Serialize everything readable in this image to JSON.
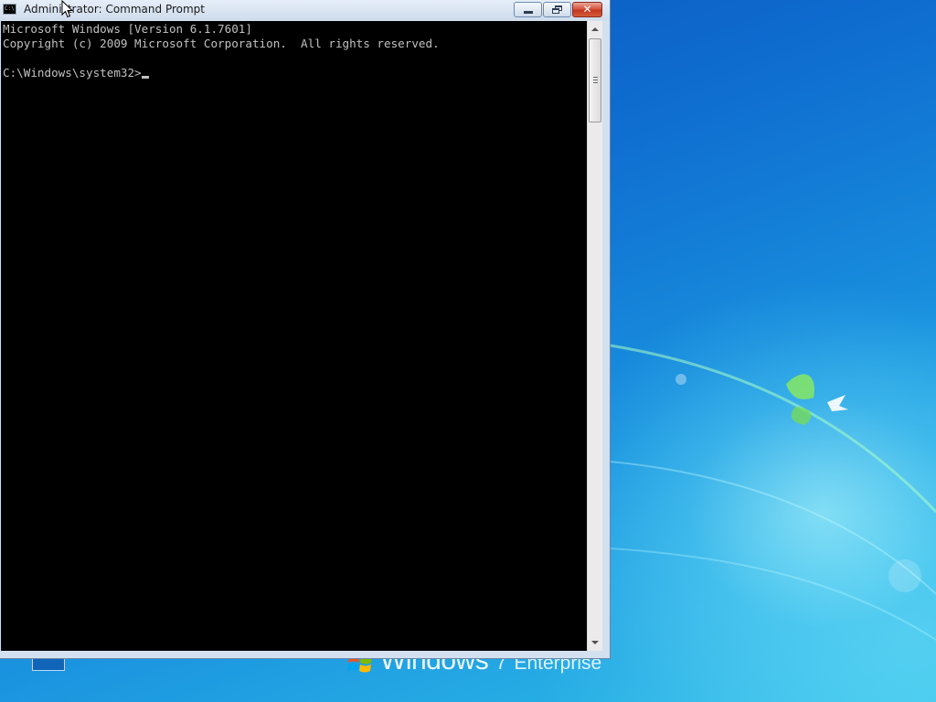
{
  "desktop": {
    "brand": {
      "name": "Windows",
      "version": "7",
      "edition": "Enterprise"
    }
  },
  "window": {
    "title": "Administrator:  Command Prompt",
    "icon_text": "C:\\",
    "buttons": {
      "minimize": "minimize",
      "maximize": "restore",
      "close": "✕"
    }
  },
  "console": {
    "lines": [
      "Microsoft Windows [Version 6.1.7601]",
      "Copyright (c) 2009 Microsoft Corporation.  All rights reserved.",
      "C:\\Windows\\system32>"
    ]
  },
  "colors": {
    "console_bg": "#000000",
    "console_fg": "#c0c0c0",
    "close_button": "#c94a2f"
  }
}
